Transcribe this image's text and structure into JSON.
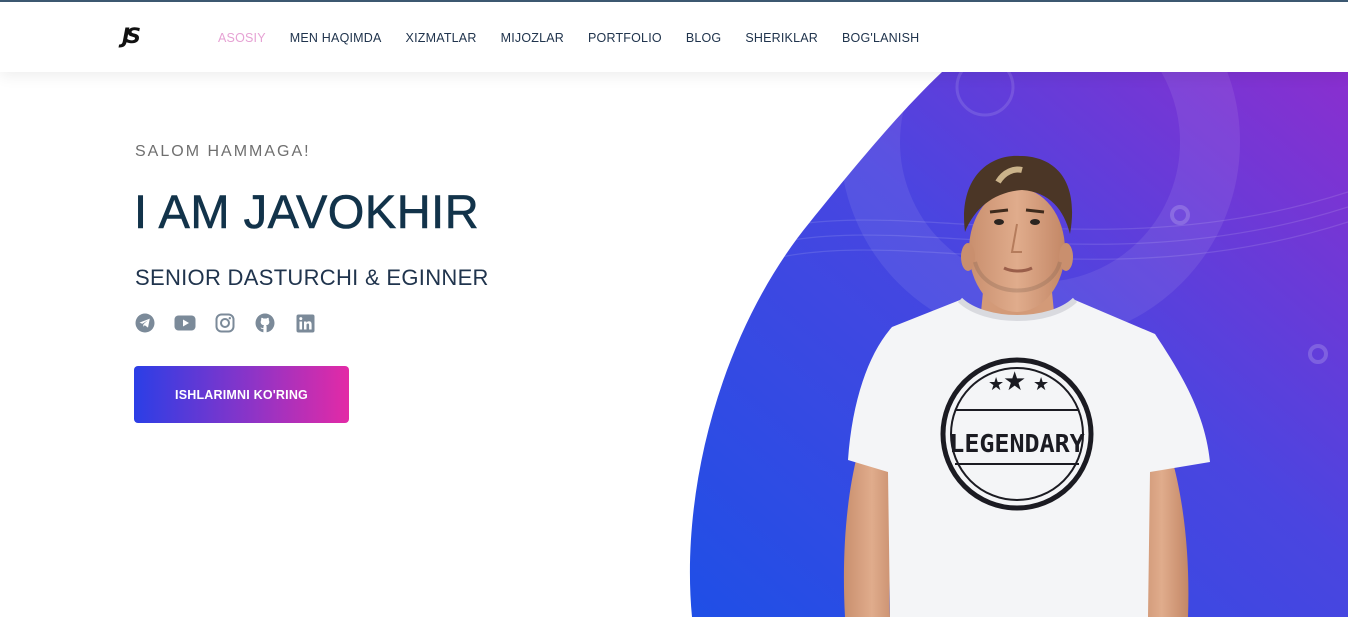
{
  "header": {
    "logo_text": "JS",
    "nav": [
      {
        "label": "ASOSIY",
        "active": true
      },
      {
        "label": "MEN HAQIMDA",
        "active": false
      },
      {
        "label": "XIZMATLAR",
        "active": false
      },
      {
        "label": "MIJOZLAR",
        "active": false
      },
      {
        "label": "PORTFOLIO",
        "active": false
      },
      {
        "label": "BLOG",
        "active": false
      },
      {
        "label": "SHERIKLAR",
        "active": false
      },
      {
        "label": "BOG'LANISH",
        "active": false
      }
    ]
  },
  "hero": {
    "greeting": "SALOM HAMMAGA!",
    "name": "I AM JAVOKHIR",
    "role": "SENIOR DASTURCHI & EGINNER",
    "socials": [
      "telegram-icon",
      "youtube-icon",
      "instagram-icon",
      "github-icon",
      "linkedin-icon"
    ],
    "cta_label": "ISHLARIMNI KO'RING",
    "shirt_text": "LEGENDARY"
  },
  "colors": {
    "nav_active": "#e6a2d4",
    "nav_text": "#20344d",
    "heading": "#12334a",
    "blob_start": "#1f4fe6",
    "blob_end": "#8a2fcf",
    "cta_start": "#2b3ee6",
    "cta_end": "#e32aa6",
    "social_icon": "#7b8a99"
  }
}
